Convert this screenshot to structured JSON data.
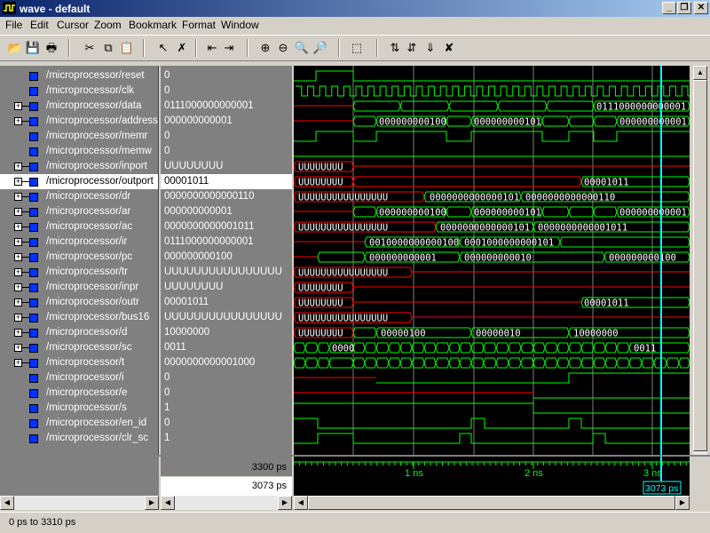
{
  "window": {
    "title": "wave - default",
    "buttons": [
      "_",
      "❐",
      "✕"
    ]
  },
  "menu": [
    "File",
    "Edit",
    "Cursor",
    "Zoom",
    "Bookmark",
    "Format",
    "Window"
  ],
  "toolbar": [
    {
      "name": "open-icon",
      "glyph": "📂"
    },
    {
      "name": "save-icon",
      "glyph": "💾"
    },
    {
      "name": "print-icon",
      "glyph": "🖶"
    },
    {
      "name": "cut-icon",
      "glyph": "✂"
    },
    {
      "name": "copy-icon",
      "glyph": "⧉"
    },
    {
      "name": "paste-icon",
      "glyph": "📋"
    },
    {
      "name": "select-pointer-icon",
      "glyph": "↖"
    },
    {
      "name": "delete-icon",
      "glyph": "✗"
    },
    {
      "name": "insert-cursor-icon",
      "glyph": "⇤"
    },
    {
      "name": "delete-cursor-icon",
      "glyph": "⇥"
    },
    {
      "name": "zoom-in-icon",
      "glyph": "⊕"
    },
    {
      "name": "zoom-out-icon",
      "glyph": "⊖"
    },
    {
      "name": "zoom-full-icon",
      "glyph": "🔍"
    },
    {
      "name": "zoom-range-icon",
      "glyph": "🔎"
    },
    {
      "name": "find-icon",
      "glyph": "⬚"
    },
    {
      "name": "prev-edge-icon",
      "glyph": "⇅"
    },
    {
      "name": "next-edge-icon",
      "glyph": "⇵"
    },
    {
      "name": "edge-down-icon",
      "glyph": "⇓"
    },
    {
      "name": "stop-icon",
      "glyph": "✘"
    }
  ],
  "signals": [
    {
      "name": "/microprocessor/reset",
      "value": "0",
      "bus": false
    },
    {
      "name": "/microprocessor/clk",
      "value": "0",
      "bus": false
    },
    {
      "name": "/microprocessor/data",
      "value": "0111000000000001",
      "bus": true
    },
    {
      "name": "/microprocessor/address",
      "value": "000000000001",
      "bus": true
    },
    {
      "name": "/microprocessor/memr",
      "value": "0",
      "bus": false
    },
    {
      "name": "/microprocessor/memw",
      "value": "0",
      "bus": false
    },
    {
      "name": "/microprocessor/inport",
      "value": "UUUUUUUU",
      "bus": true
    },
    {
      "name": "/microprocessor/outport",
      "value": "00001011",
      "bus": true,
      "selected": true
    },
    {
      "name": "/microprocessor/dr",
      "value": "0000000000000110",
      "bus": true
    },
    {
      "name": "/microprocessor/ar",
      "value": "000000000001",
      "bus": true
    },
    {
      "name": "/microprocessor/ac",
      "value": "0000000000001011",
      "bus": true
    },
    {
      "name": "/microprocessor/ir",
      "value": "0111000000000001",
      "bus": true
    },
    {
      "name": "/microprocessor/pc",
      "value": "000000000100",
      "bus": true
    },
    {
      "name": "/microprocessor/tr",
      "value": "UUUUUUUUUUUUUUUU",
      "bus": true
    },
    {
      "name": "/microprocessor/inpr",
      "value": "UUUUUUUU",
      "bus": true
    },
    {
      "name": "/microprocessor/outr",
      "value": "00001011",
      "bus": true
    },
    {
      "name": "/microprocessor/bus16",
      "value": "UUUUUUUUUUUUUUUU",
      "bus": true
    },
    {
      "name": "/microprocessor/d",
      "value": "10000000",
      "bus": true
    },
    {
      "name": "/microprocessor/sc",
      "value": "0011",
      "bus": true
    },
    {
      "name": "/microprocessor/t",
      "value": "0000000000001000",
      "bus": true
    },
    {
      "name": "/microprocessor/i",
      "value": "0",
      "bus": false
    },
    {
      "name": "/microprocessor/e",
      "value": "0",
      "bus": false
    },
    {
      "name": "/microprocessor/s",
      "value": "1",
      "bus": false
    },
    {
      "name": "/microprocessor/en_id",
      "value": "0",
      "bus": false
    },
    {
      "name": "/microprocessor/clr_sc",
      "value": "1",
      "bus": false
    }
  ],
  "wave_labels": [
    {
      "row": 2,
      "text": "0111000000000001"
    },
    {
      "row": 3,
      "text": "000000000100"
    },
    {
      "row": 3,
      "text": "000000000101"
    },
    {
      "row": 3,
      "text": "000000000001"
    },
    {
      "row": 6,
      "text": "UUUUUUUU"
    },
    {
      "row": 7,
      "text": "UUUUUUUU"
    },
    {
      "row": 7,
      "text": "00001011"
    },
    {
      "row": 8,
      "text": "UUUUUUUUUUUUUUUU"
    },
    {
      "row": 8,
      "text": "0000000000000101"
    },
    {
      "row": 8,
      "text": "0000000000000110"
    },
    {
      "row": 9,
      "text": "000000000100"
    },
    {
      "row": 9,
      "text": "000000000101"
    },
    {
      "row": 9,
      "text": "000000000001"
    },
    {
      "row": 10,
      "text": "UUUUUUUUUUUUUUUU"
    },
    {
      "row": 10,
      "text": "0000000000000101"
    },
    {
      "row": 10,
      "text": "0000000000001011"
    },
    {
      "row": 11,
      "text": "0010000000000100"
    },
    {
      "row": 11,
      "text": "0001000000000101"
    },
    {
      "row": 12,
      "text": "000000000001"
    },
    {
      "row": 12,
      "text": "000000000010"
    },
    {
      "row": 12,
      "text": "000000000100"
    },
    {
      "row": 13,
      "text": "UUUUUUUUUUUUUUUU"
    },
    {
      "row": 14,
      "text": "UUUUUUUU"
    },
    {
      "row": 15,
      "text": "UUUUUUUU"
    },
    {
      "row": 15,
      "text": "00001011"
    },
    {
      "row": 16,
      "text": "UUUUUUUUUUUUUUUU"
    },
    {
      "row": 17,
      "text": "UUUUUUUU"
    },
    {
      "row": 17,
      "text": "00000100"
    },
    {
      "row": 17,
      "text": "00000010"
    },
    {
      "row": 17,
      "text": "10000000"
    },
    {
      "row": 18,
      "text": "0000"
    },
    {
      "row": 18,
      "text": "0011"
    }
  ],
  "timeline": {
    "ticks": [
      "1 ns",
      "2 ns",
      "3 ns"
    ],
    "cursor_label": "3073 ps"
  },
  "now_time": "3300 ps",
  "cursor_time": "3073 ps",
  "status": "0 ps to 3310 ps",
  "colors": {
    "wave": "#00ff00",
    "undefined": "#ff0000",
    "cursor": "#00ffff",
    "grid": "#808080",
    "selected_bg": "#ffffff"
  }
}
